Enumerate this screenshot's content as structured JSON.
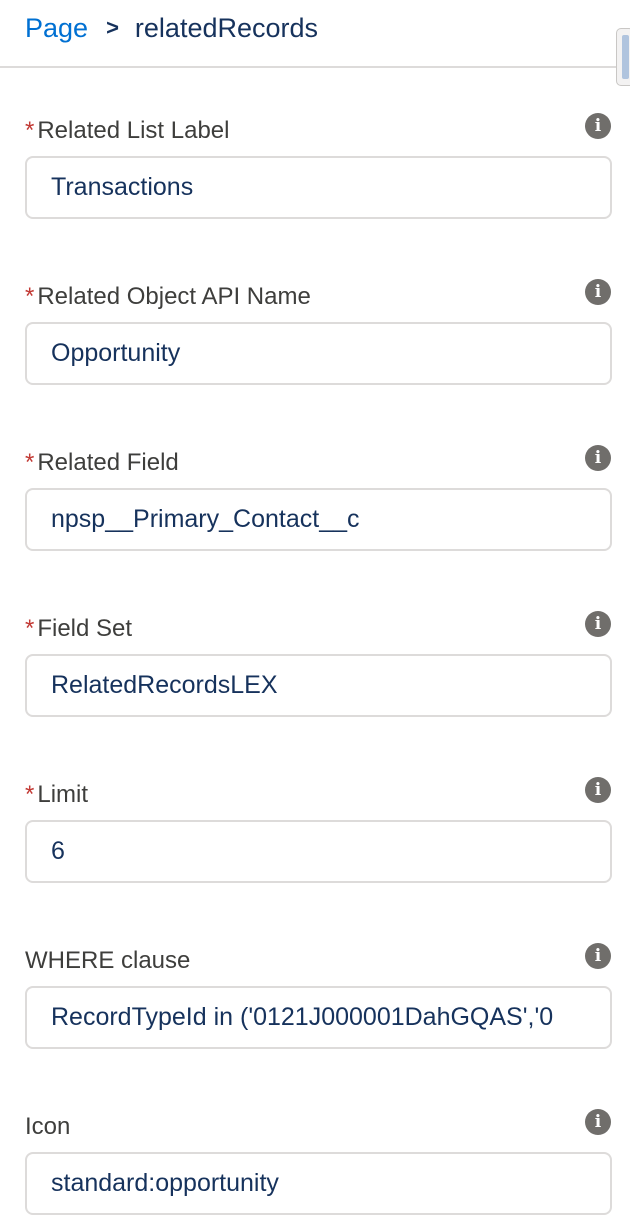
{
  "breadcrumb": {
    "root": "Page",
    "separator": ">",
    "current": "relatedRecords"
  },
  "fields": [
    {
      "label": "Related List Label",
      "required": true,
      "value": "Transactions"
    },
    {
      "label": "Related Object API Name",
      "required": true,
      "value": "Opportunity"
    },
    {
      "label": "Related Field",
      "required": true,
      "value": "npsp__Primary_Contact__c"
    },
    {
      "label": "Field Set",
      "required": true,
      "value": "RelatedRecordsLEX"
    },
    {
      "label": "Limit",
      "required": true,
      "value": "6"
    },
    {
      "label": "WHERE clause",
      "required": false,
      "value": "RecordTypeId in ('0121J000001DahGQAS','0"
    },
    {
      "label": "Icon",
      "required": false,
      "value": "standard:opportunity"
    }
  ],
  "required_marker": "*",
  "info_icon_glyph": "i",
  "colors": {
    "link": "#0070d2",
    "text": "#16325c",
    "label": "#3e3e3c",
    "required": "#c23934",
    "border": "#dddbda",
    "icon": "#706e6b"
  }
}
